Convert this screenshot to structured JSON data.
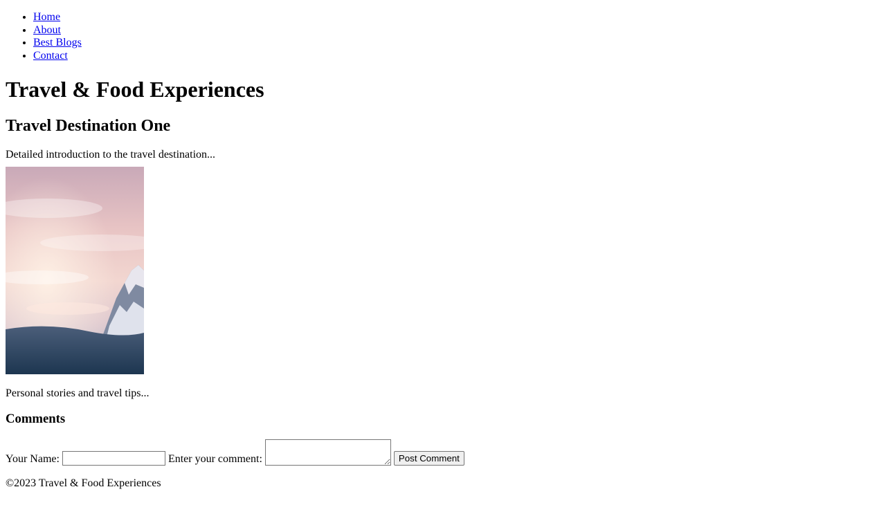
{
  "nav": {
    "items": [
      {
        "label": "Home"
      },
      {
        "label": "About"
      },
      {
        "label": "Best Blogs"
      },
      {
        "label": "Contact"
      }
    ]
  },
  "header": {
    "title": "Travel & Food Experiences"
  },
  "article": {
    "title": "Travel Destination One",
    "intro": "Detailed introduction to the travel destination...",
    "image_description": "snowy mountain peak under a pink sky",
    "stories": "Personal stories and travel tips..."
  },
  "comments": {
    "heading": "Comments",
    "name_label": "Your Name:",
    "name_value": "",
    "comment_label": "Enter your comment:",
    "comment_value": "",
    "submit_label": "Post Comment"
  },
  "footer": {
    "copyright": "©2023 Travel & Food Experiences"
  },
  "colors": {
    "link": "#0000ee",
    "text": "#000000",
    "background": "#ffffff"
  }
}
